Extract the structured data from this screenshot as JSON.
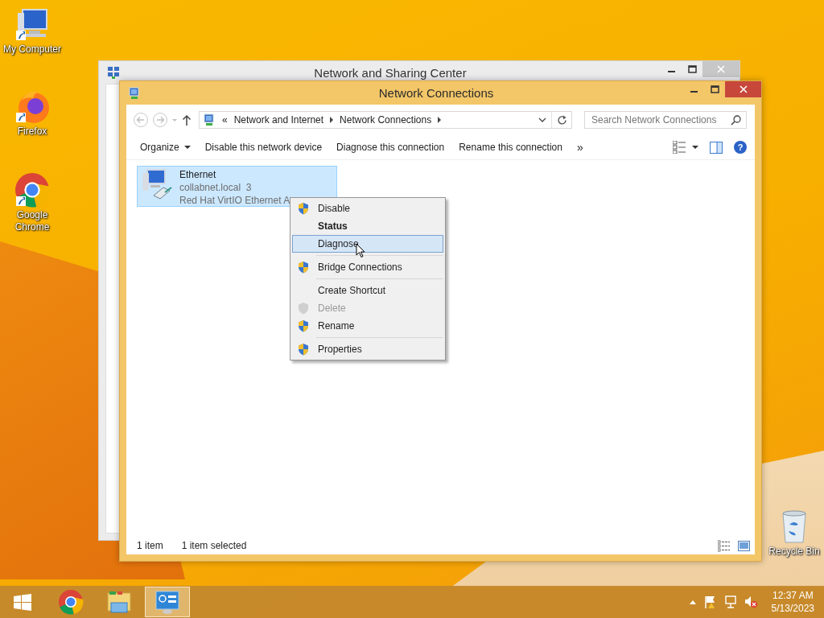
{
  "desktop_icons": [
    {
      "label": "My Computer",
      "kind": "computer"
    },
    {
      "label": "Firefox",
      "kind": "firefox"
    },
    {
      "label": "Google Chrome",
      "kind": "chrome"
    }
  ],
  "recycle_bin": {
    "label": "Recycle Bin"
  },
  "background_window": {
    "title": "Network and Sharing Center"
  },
  "window": {
    "title": "Network Connections",
    "address_bar": {
      "overflow": "«",
      "path": [
        "Network and Internet",
        "Network Connections"
      ]
    },
    "search": {
      "placeholder": "Search Network Connections"
    },
    "help": "?",
    "toolbar": [
      {
        "label": "Organize",
        "kind": "menu"
      },
      {
        "label": "Disable this network device",
        "kind": "command"
      },
      {
        "label": "Diagnose this connection",
        "kind": "command"
      },
      {
        "label": "Rename this connection",
        "kind": "command"
      },
      {
        "label": "»",
        "kind": "more"
      }
    ],
    "connections": [
      {
        "name": "Ethernet",
        "network": "collabnet.local  3",
        "adapter": "Red Hat VirtIO Ethernet A",
        "selected": true
      }
    ],
    "status_bar": {
      "count": "1 item",
      "selection": "1 item selected"
    }
  },
  "context_menu": [
    {
      "kind": "shield",
      "label": "Disable",
      "default": false,
      "disabled": false,
      "selected": false
    },
    {
      "kind": "plain",
      "label": "Status",
      "default": true,
      "disabled": false,
      "selected": false
    },
    {
      "kind": "plain",
      "label": "Diagnose",
      "default": false,
      "disabled": false,
      "selected": true
    },
    {
      "kind": "separator"
    },
    {
      "kind": "shield",
      "label": "Bridge Connections",
      "default": false,
      "disabled": false,
      "selected": false
    },
    {
      "kind": "separator"
    },
    {
      "kind": "plain",
      "label": "Create Shortcut",
      "default": false,
      "disabled": false,
      "selected": false
    },
    {
      "kind": "shield",
      "label": "Delete",
      "default": false,
      "disabled": true,
      "selected": false
    },
    {
      "kind": "shield",
      "label": "Rename",
      "default": false,
      "disabled": false,
      "selected": false
    },
    {
      "kind": "separator"
    },
    {
      "kind": "shield",
      "label": "Properties",
      "default": false,
      "disabled": false,
      "selected": false
    }
  ],
  "taskbar": {
    "apps": [
      {
        "kind": "chrome",
        "selected": false
      },
      {
        "kind": "explorer",
        "selected": false
      },
      {
        "kind": "control-panel",
        "selected": true
      }
    ],
    "clock": {
      "time": "12:37 AM",
      "date": "5/13/2023"
    }
  }
}
